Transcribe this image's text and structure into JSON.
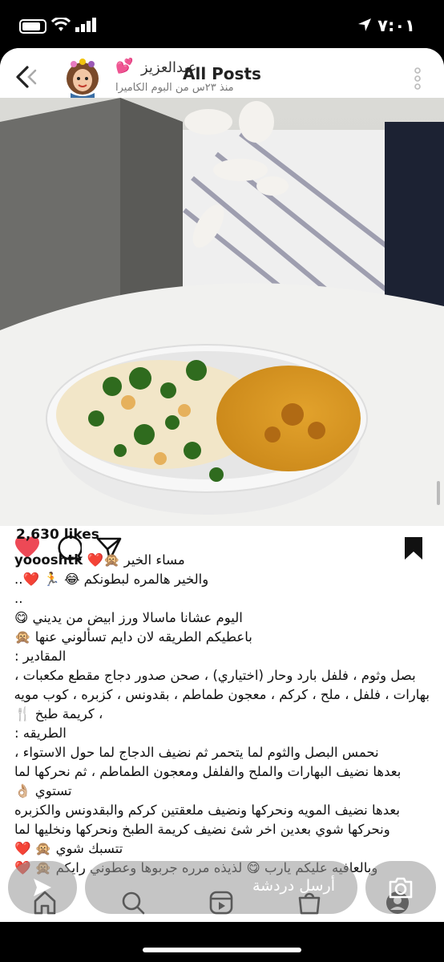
{
  "status_bar": {
    "time": "٧:٠١"
  },
  "header": {
    "title": "All Posts",
    "author": "عبدالعزيز",
    "subtitle": "منذ ٢٣س من البوم الكاميرا"
  },
  "post": {
    "likes": "2,630 likes",
    "username": "yoooshtk",
    "caption_lines": [
      "مساء الخير 🙊❤️",
      "والخير هالمره لبطونكم 😂 🏃 ❤️..",
      "..",
      "اليوم عشانا ماسالا ورز ابيض من يديني 😋",
      "باعطيكم الطريقه لان دايم تسألوني عنها 🙊",
      "المقادير :",
      "بصل وثوم ، فلفل بارد وحار (اختياري) ، صحن صدور دجاج مقطع مكعبات ،",
      "بهارات ، فلفل ، ملح ، كركم ، معجون طماطم ، بقدونس ، كزبره ، كوب مويه",
      "، كريمة طبخ 🍴",
      "الطريقه :",
      "نحمس البصل والثوم لما يتحمر ثم نضيف الدجاج لما حول الاستواء ،",
      "بعدها نضيف البهارات والملح والفلفل ومعجون الطماطم ، ثم نحركها لما",
      "تستوي 👌🏼",
      "بعدها نضيف المويه ونحركها ونضيف ملعقتين كركم والبقدونس والكزبره",
      "ونحركها شوي بعدين اخر شئ نضيف كريمة الطبخ ونحركها ونخليها لما",
      "تتسبك شوي 🙊 ❤️",
      "وبالعافيه عليكم يارب 😋 لذيذه مرره جربوها وعطوني رايكم 🙊 ❤️"
    ]
  },
  "chat_bar": {
    "placeholder": "أرسل دردشة"
  },
  "icons": {
    "back": "back-chevron-icon",
    "like": "heart-icon",
    "comment": "comment-icon",
    "share": "share-icon",
    "bookmark": "bookmark-icon",
    "more": "more-icon",
    "send": "send-icon",
    "camera": "camera-icon",
    "tabs": [
      "home-icon",
      "search-icon",
      "reels-icon",
      "shop-icon",
      "profile-icon"
    ]
  },
  "colors": {
    "like": "#ed4956",
    "text": "#111111"
  }
}
